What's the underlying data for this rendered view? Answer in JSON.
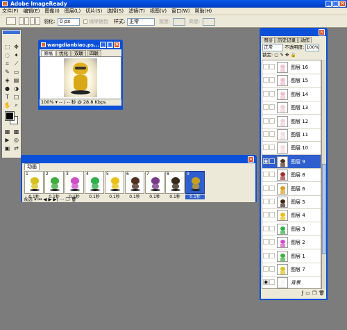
{
  "app": {
    "title": "Adobe ImageReady"
  },
  "menu": [
    "文件(F)",
    "编辑(E)",
    "图像(I)",
    "图层(L)",
    "切片(S)",
    "选择(S)",
    "滤镜(T)",
    "视图(V)",
    "窗口(W)",
    "帮助(H)"
  ],
  "options": {
    "feather_label": "羽化:",
    "feather_value": "0 px",
    "antialias_label": "消除锯齿",
    "style_label": "样式:",
    "style_value": "正常",
    "width_label": "宽度:",
    "height_label": "高度:"
  },
  "document": {
    "title": "wangdianbiao.ps...",
    "tabs": [
      "原稿",
      "优化",
      "双联",
      "四联"
    ],
    "zoom": "100%",
    "status": "-- / -- 秒 @ 28.8 Kbps"
  },
  "animation": {
    "tab": "动画",
    "frames": [
      {
        "num": "1",
        "delay": "0.1秒",
        "color": "#d8c020"
      },
      {
        "num": "2",
        "delay": "0.1秒",
        "color": "#3fae3f"
      },
      {
        "num": "3",
        "delay": "0.1秒",
        "color": "#d050c8"
      },
      {
        "num": "4",
        "delay": "0.1秒",
        "color": "#2fb04a"
      },
      {
        "num": "5",
        "delay": "0.1秒",
        "color": "#e8c018"
      },
      {
        "num": "6",
        "delay": "0.1秒",
        "color": "#503020"
      },
      {
        "num": "7",
        "delay": "0.1秒",
        "color": "#7a3a8a"
      },
      {
        "num": "8",
        "delay": "0.1秒",
        "color": "#3a2a1a"
      },
      {
        "num": "9",
        "delay": "0.1秒",
        "color": "#c8a020"
      }
    ],
    "loop": "永远"
  },
  "layers": {
    "tabs": [
      "图层",
      "历史记录",
      "动作"
    ],
    "blend": "正常",
    "opacity_label": "不透明度:",
    "opacity": "100%",
    "lock_label": "锁定:",
    "items": [
      {
        "name": "图层 16",
        "color": "#f0c0d0"
      },
      {
        "name": "图层 15",
        "color": "#f0c0d0"
      },
      {
        "name": "图层 14",
        "color": "#f0c0d0"
      },
      {
        "name": "图层 13",
        "color": "#f0d0d8"
      },
      {
        "name": "图层 12",
        "color": "#f0d0d8"
      },
      {
        "name": "图层 11",
        "color": "#f4dce0"
      },
      {
        "name": "图层 10",
        "color": "#f4dce0"
      },
      {
        "name": "图层 9",
        "color": "#503020"
      },
      {
        "name": "图层 8",
        "color": "#a03030"
      },
      {
        "name": "图层 6",
        "color": "#d8a020"
      },
      {
        "name": "图层 5",
        "color": "#402818"
      },
      {
        "name": "图层 4",
        "color": "#e8c018"
      },
      {
        "name": "图层 3",
        "color": "#2fb04a"
      },
      {
        "name": "图层 2",
        "color": "#d050c8"
      },
      {
        "name": "图层 1",
        "color": "#3fae3f"
      },
      {
        "name": "图层 7",
        "color": "#d8c020"
      },
      {
        "name": "背景",
        "color": "#f6f6f6"
      }
    ],
    "selected": "图层 9"
  }
}
